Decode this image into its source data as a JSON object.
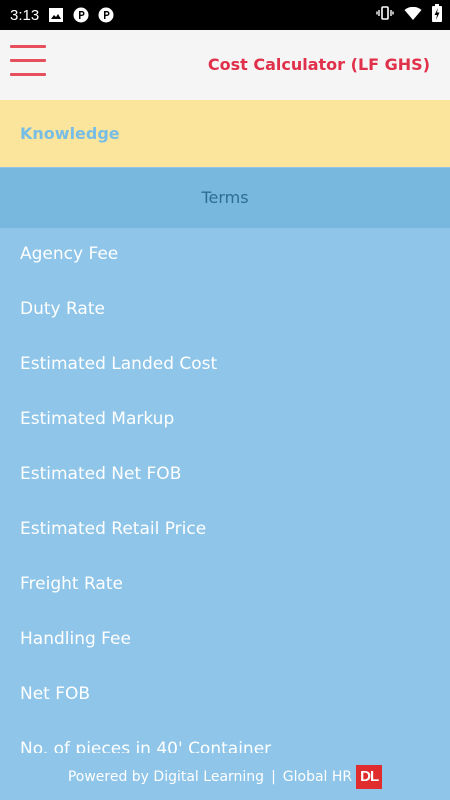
{
  "status_bar": {
    "time": "3:13",
    "left_icons": [
      "image-icon",
      "parking-icon",
      "parking-icon"
    ],
    "right_icons": [
      "vibrate-icon",
      "wifi-icon",
      "battery-charging-icon"
    ]
  },
  "app_bar": {
    "title": "Cost Calculator (LF GHS)",
    "menu_icon": "hamburger-menu-icon",
    "accent_color": "#e0304a"
  },
  "section": {
    "title": "Knowledge"
  },
  "terms": {
    "header": "Terms",
    "items": [
      "Agency Fee",
      "Duty Rate",
      "Estimated Landed Cost",
      "Estimated Markup",
      "Estimated Net FOB",
      "Estimated Retail Price",
      "Freight Rate",
      "Handling Fee",
      "Net FOB",
      "No. of pieces in 40' Container"
    ]
  },
  "footer": {
    "powered_by": "Powered by Digital Learning",
    "separator": "|",
    "partner": "Global HR",
    "logo_text": "DL"
  },
  "colors": {
    "list_background": "#8ec5e8",
    "header_background": "#78b8de",
    "knowledge_background": "#fbe49c"
  }
}
